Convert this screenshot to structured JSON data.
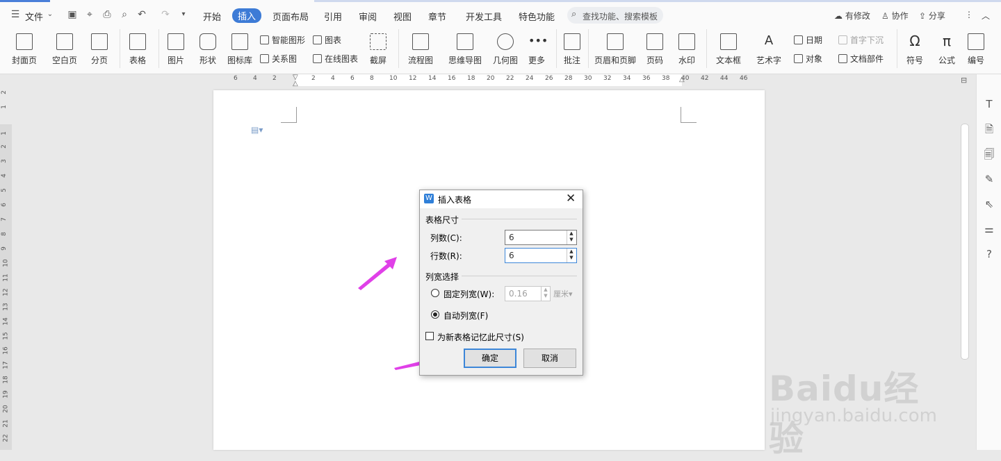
{
  "menubar": {
    "file_label": "文件",
    "items": [
      "开始",
      "插入",
      "页面布局",
      "引用",
      "审阅",
      "视图",
      "章节",
      "开发工具",
      "特色功能"
    ],
    "active_item": "插入",
    "search_placeholder": "查找功能、搜索模板",
    "modify_label": "有修改",
    "collab_label": "协作",
    "share_label": "分享"
  },
  "ribbon": {
    "cover_page": "封面页",
    "blank_page": "空白页",
    "page_break": "分页",
    "table": "表格",
    "picture": "图片",
    "shape": "形状",
    "icon_library": "图标库",
    "smart_graphic": "智能图形",
    "chart": "图表",
    "relation_graph": "关系图",
    "online_chart": "在线图表",
    "screenshot": "截屏",
    "flowchart": "流程图",
    "mindmap": "思维导图",
    "geometry": "几何图",
    "more": "更多",
    "comment": "批注",
    "header_footer": "页眉和页脚",
    "page_number": "页码",
    "watermark": "水印",
    "textbox": "文本框",
    "wordart": "艺术字",
    "date": "日期",
    "object": "对象",
    "drop_cap": "首字下沉",
    "doc_parts": "文档部件",
    "symbol": "符号",
    "formula": "公式",
    "numbering": "编号"
  },
  "hruler_ticks": [
    "6",
    "4",
    "2",
    "2",
    "4",
    "6",
    "8",
    "10",
    "12",
    "14",
    "16",
    "18",
    "20",
    "22",
    "24",
    "26",
    "28",
    "30",
    "32",
    "34",
    "36",
    "38",
    "40",
    "42",
    "44",
    "46"
  ],
  "vruler_ticks": [
    "2",
    "1",
    "1",
    "2",
    "3",
    "4",
    "5",
    "6",
    "7",
    "8",
    "9",
    "10",
    "11",
    "12",
    "13",
    "14",
    "15",
    "16",
    "17",
    "18",
    "19",
    "20",
    "21",
    "22"
  ],
  "dialog": {
    "title": "插入表格",
    "size_group": "表格尺寸",
    "cols_label": "列数(C):",
    "cols_value": "6",
    "rows_label": "行数(R):",
    "rows_value": "6",
    "width_group": "列宽选择",
    "fixed_width_label": "固定列宽(W):",
    "fixed_width_value": "0.16",
    "unit": "厘米",
    "auto_width_label": "自动列宽(F)",
    "remember_label": "为新表格记忆此尺寸(S)",
    "ok_label": "确定",
    "cancel_label": "取消"
  },
  "watermark": {
    "brand": "Baidu经验",
    "url": "jingyan.baidu.com"
  },
  "colors": {
    "accent": "#3d7bd6",
    "arrow": "#e040e8",
    "focus_border": "#3c86d8"
  }
}
